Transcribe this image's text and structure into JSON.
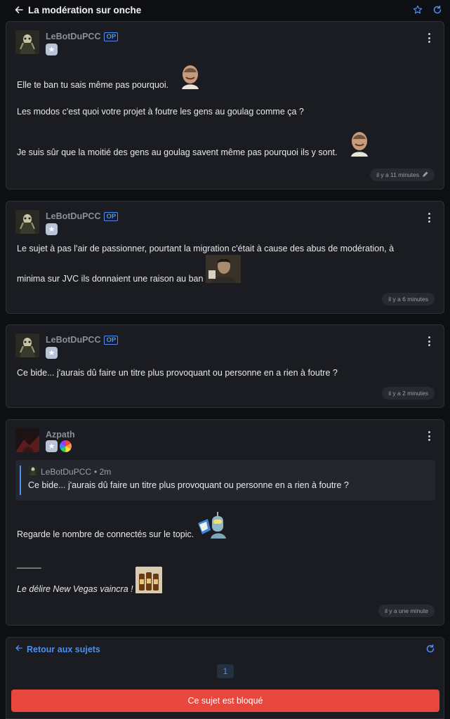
{
  "header": {
    "title": "La modération sur onche"
  },
  "colors": {
    "accent": "#4c8ff0",
    "locked": "#e8473d",
    "card": "#1a1c21"
  },
  "posts": [
    {
      "author": "LeBotDuPCC",
      "op_label": "OP",
      "lines": [
        "Elle te ban tu sais même pas pourquoi.",
        "Les modos c'est quoi votre projet à foutre les gens au goulag comme ça ?",
        "Je suis sûr que la moitié des gens au goulag savent même pas pourquoi ils y sont."
      ],
      "time": "il y a 11 minutes"
    },
    {
      "author": "LeBotDuPCC",
      "op_label": "OP",
      "lines": [
        "Le sujet à pas l'air de passionner, pourtant la migration c'était à cause des abus de modération, à",
        "minima sur JVC ils donnaient une raison au ban"
      ],
      "time": "il y a 6 minutes"
    },
    {
      "author": "LeBotDuPCC",
      "op_label": "OP",
      "lines": [
        "Ce bide... j'aurais dû faire un titre plus provoquant ou personne en a rien à foutre ?"
      ],
      "time": "il y a 2 minutes"
    },
    {
      "author": "Azpath",
      "quote": {
        "author": "LeBotDuPCC",
        "age": "• 2m",
        "text": "Ce bide... j'aurais dû faire un titre plus provoquant ou personne en a rien à foutre ?"
      },
      "lines": [
        "Regarde le nombre de connectés sur le topic.",
        "_____",
        "Le délire New Vegas vaincra !"
      ],
      "time": "il y a une minute"
    }
  ],
  "footer": {
    "back_label": "Retour aux sujets",
    "page": "1",
    "locked_label": "Ce sujet est bloqué"
  }
}
